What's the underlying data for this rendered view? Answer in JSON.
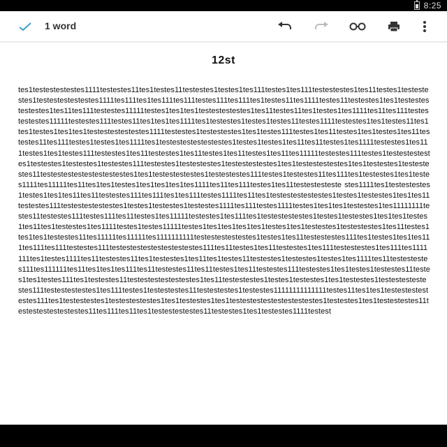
{
  "status_bar": {
    "time": "8:25"
  },
  "toolbar": {
    "word_count": "1 word",
    "icons": [
      "check-icon",
      "undo-icon",
      "redo-icon",
      "view-icon",
      "print-format-icon",
      "more-vert-icon"
    ]
  },
  "document": {
    "title": "12st",
    "body": "tes1testestestestes1111testestes11tes1testes11testestes1testes1tes111testes1tes111testestestes1tes11testes1testestestes1testestestestestes1111tes111tes1tes111tes111testes111tes111tes1testes11tes1111testes11testestes1tes1testestestestestes1tes11tes111testestes11111testes1tes1tes1testestestestes1tes11testes11tes1testes1tes1111tes11tes111testestestestes11111testestes111testes11tes1tes1tes1111tes1testestes1testes1testes11testes1111testestes1tes1testes11tes1tes1testes1tes1tes1testestestestestes1111testestes1testestestes1tes1testes111testes1tes11testes1tes1testes1tes11testestes11tes111testes1testes1tes1111tes1testestestestestestes1testes1testes1tes11tes11testes1tes1111testestes1tes111testes1tes1testes111testestes1tes11testestes1tes11testes1tes11testes1tes11tes11111testestes111testes1testestestestes1testestes1testestes1testestes111testestes1testestestes1testestestestes1tes1testestestestes1tes1testestes1testestestes11testestestestestestestestes1tes1testestestestes1testestestes111testes1testestes11tes111tes1testestes1tes1testes1111tes11111tes11tes1tes1testes1tes1tes1tes1tes1111tes11tes111testes1tes11testestesteste stes1111tes1testestestes1testes1tes1tes11tes11testestes111tes111tes1tes111testes1111tes11tes1testestestestestes1testes1testestes1tes1tes11testestes111testestestestestes1testes1testestes1testestes1111tes111testes1111testes1tes1tes1testestes1tes11111111testes11testestes111testes111tes11testes1tes11111testestes1tes111tes1testestestestes1testes1testestes1tes1tes1testes1tes11tes1testestes1tes1111testes1testes11111testes1tes1tes1tes1tes1testes1tes1testestes1testestestes1tes11testes1tes1tes1testestes11tes11111tes11111tes1111111111testestestestestes1testes1tes11testestestes111tes1testes1tes1tes111tes111tes111testestes111testestestestestestestestes111tes11testes1tes11testestes1tes111testestestes1tes111tes1111111tes1testes1111tes11testestes11tes1testestes1tes11tes1testes11testestes1testestes1testes1tes1111tes11testestestes111tes111111tes11tes1tes1tes111tes11testestes11tes11testes1tes11testestes111testestes1tes1testes1testestes11testes1tes1testes111tes1testestes11testestestestestestes1tes11testestestes1testes1testestes1tes1testestes1testestestestestes111testestestestes1tes111testes1testestestes11testestestes1testestes11111111111111testes11tes1tes1testestestestestes111tes1testestestes1testestestestes1tes1testestes1tes1testestestestestestestestes1testestes1tes1testestestes11testestestestestestes11tes111tes11tes1testestestestes11testestes1tes1testestes1111testest"
  },
  "colors": {
    "accent": "#3aa0c8",
    "icon": "#333333",
    "disabled_icon": "#bbbbbb"
  }
}
